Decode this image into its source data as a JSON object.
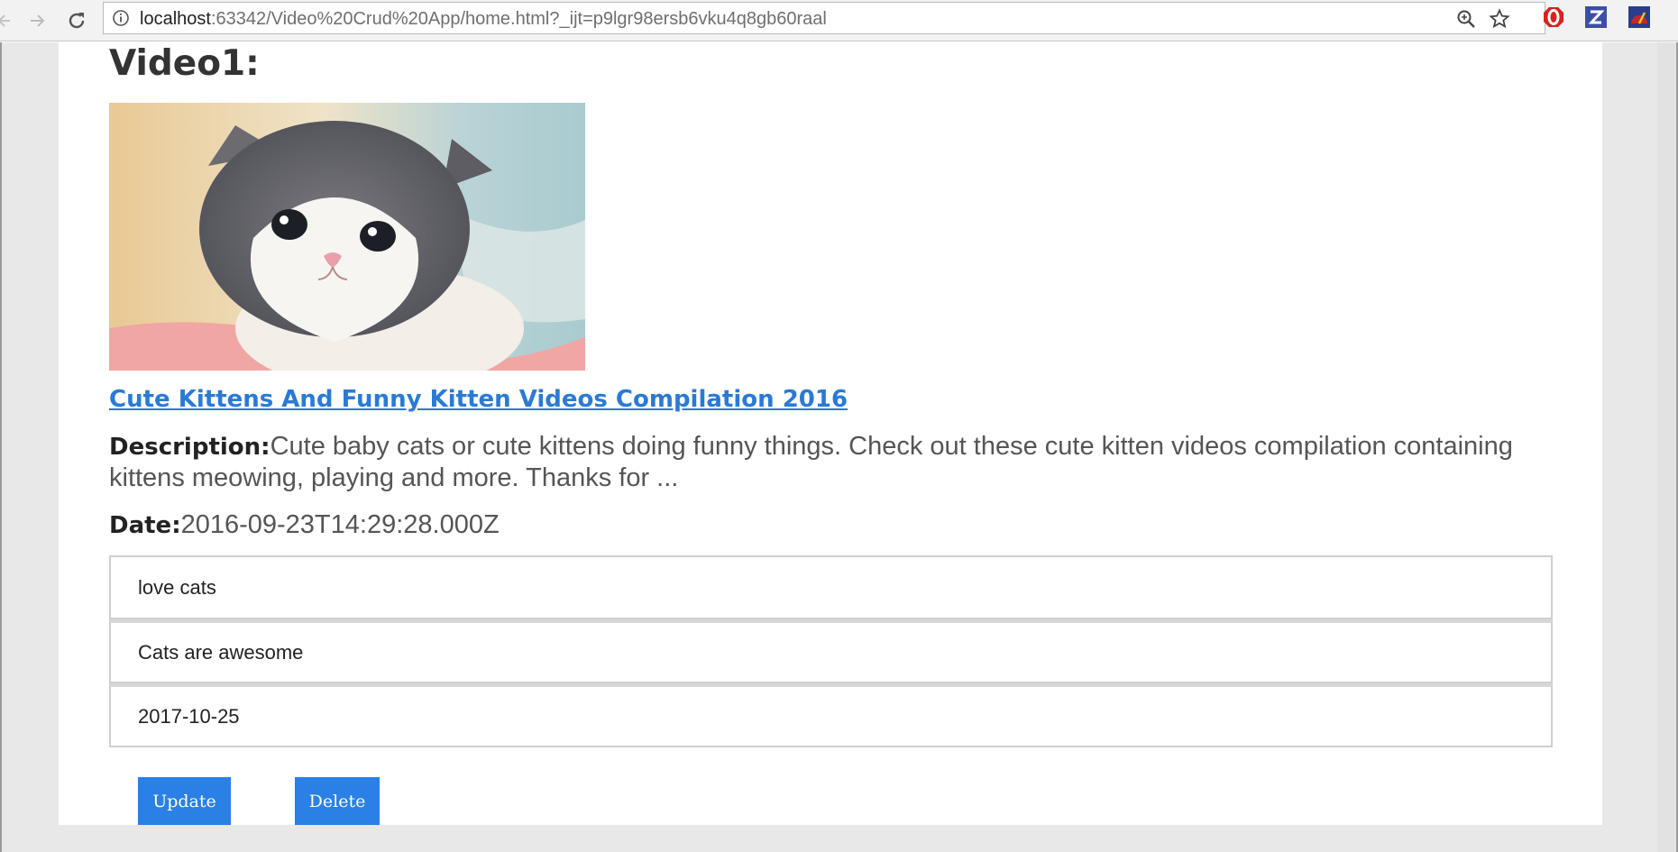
{
  "browser": {
    "url_host": "localhost",
    "url_rest": ":63342/Video%20Crud%20App/home.html?_ijt=p9lgr98ersb6vku4q8gb60raal",
    "icons": [
      "back-arrow-icon",
      "forward-arrow-icon",
      "reload-icon",
      "info-icon",
      "zoom-icon",
      "star-icon",
      "opera-extension-icon",
      "z-extension-icon",
      "speed-extension-icon"
    ]
  },
  "video": {
    "heading": "Video1:",
    "thumbnail": "kitten-thumbnail",
    "title": "Cute Kittens And Funny Kitten Videos Compilation 2016",
    "description_label": "Description:",
    "description": "Cute baby cats or cute kittens doing funny things. Check out these cute kitten videos compilation containing kittens meowing, playing and more. Thanks for ...",
    "date_label": "Date:",
    "date": "2016-09-23T14:29:28.000Z"
  },
  "details": [
    "love cats",
    "Cats are awesome",
    "2017-10-25"
  ],
  "buttons": {
    "update": "Update",
    "delete": "Delete"
  },
  "colors": {
    "link": "#2a7ad6",
    "button": "#2a80e4"
  }
}
